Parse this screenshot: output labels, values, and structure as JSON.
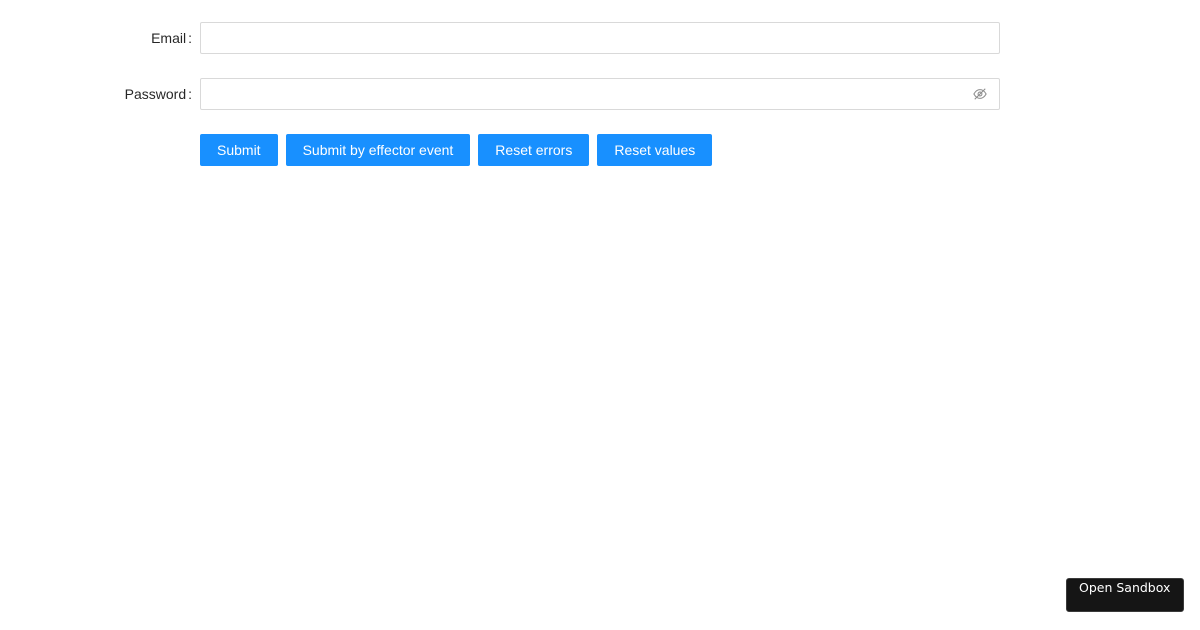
{
  "form": {
    "email": {
      "label": "Email",
      "value": "",
      "placeholder": ""
    },
    "password": {
      "label": "Password",
      "value": "",
      "placeholder": "",
      "toggle_icon": "eye-invisible-icon"
    },
    "colon": ":"
  },
  "buttons": {
    "submit": "Submit",
    "submit_effector": "Submit by effector event",
    "reset_errors": "Reset errors",
    "reset_values": "Reset values"
  },
  "sandbox": {
    "label": "Open Sandbox"
  },
  "colors": {
    "primary": "#1890ff",
    "border": "#d9d9d9",
    "sandbox_bg": "#151515"
  }
}
